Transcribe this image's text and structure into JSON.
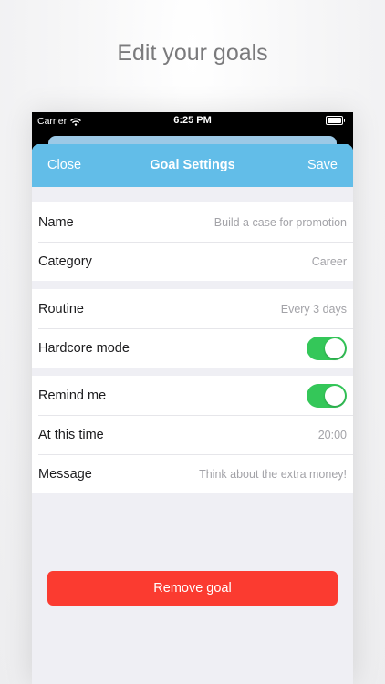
{
  "headline": "Edit your goals",
  "status_bar": {
    "carrier": "Carrier",
    "time": "6:25 PM",
    "icons": [
      "wifi-icon",
      "battery-icon"
    ]
  },
  "nav": {
    "left": "Close",
    "title": "Goal Settings",
    "right": "Save",
    "color": "#62bde8"
  },
  "groups": [
    {
      "rows": [
        {
          "label": "Name",
          "value": "Build a case for promotion"
        },
        {
          "label": "Category",
          "value": "Career"
        }
      ]
    },
    {
      "rows": [
        {
          "label": "Routine",
          "value": "Every 3 days"
        },
        {
          "label": "Hardcore mode",
          "toggle": true
        }
      ]
    },
    {
      "rows": [
        {
          "label": "Remind me",
          "toggle": true
        },
        {
          "label": "At this time",
          "value": "20:00"
        },
        {
          "label": "Message",
          "value": "Think about the extra money!"
        }
      ]
    }
  ],
  "remove_button": "Remove goal",
  "colors": {
    "toggle_on": "#34c759",
    "destructive": "#fb3b30"
  }
}
